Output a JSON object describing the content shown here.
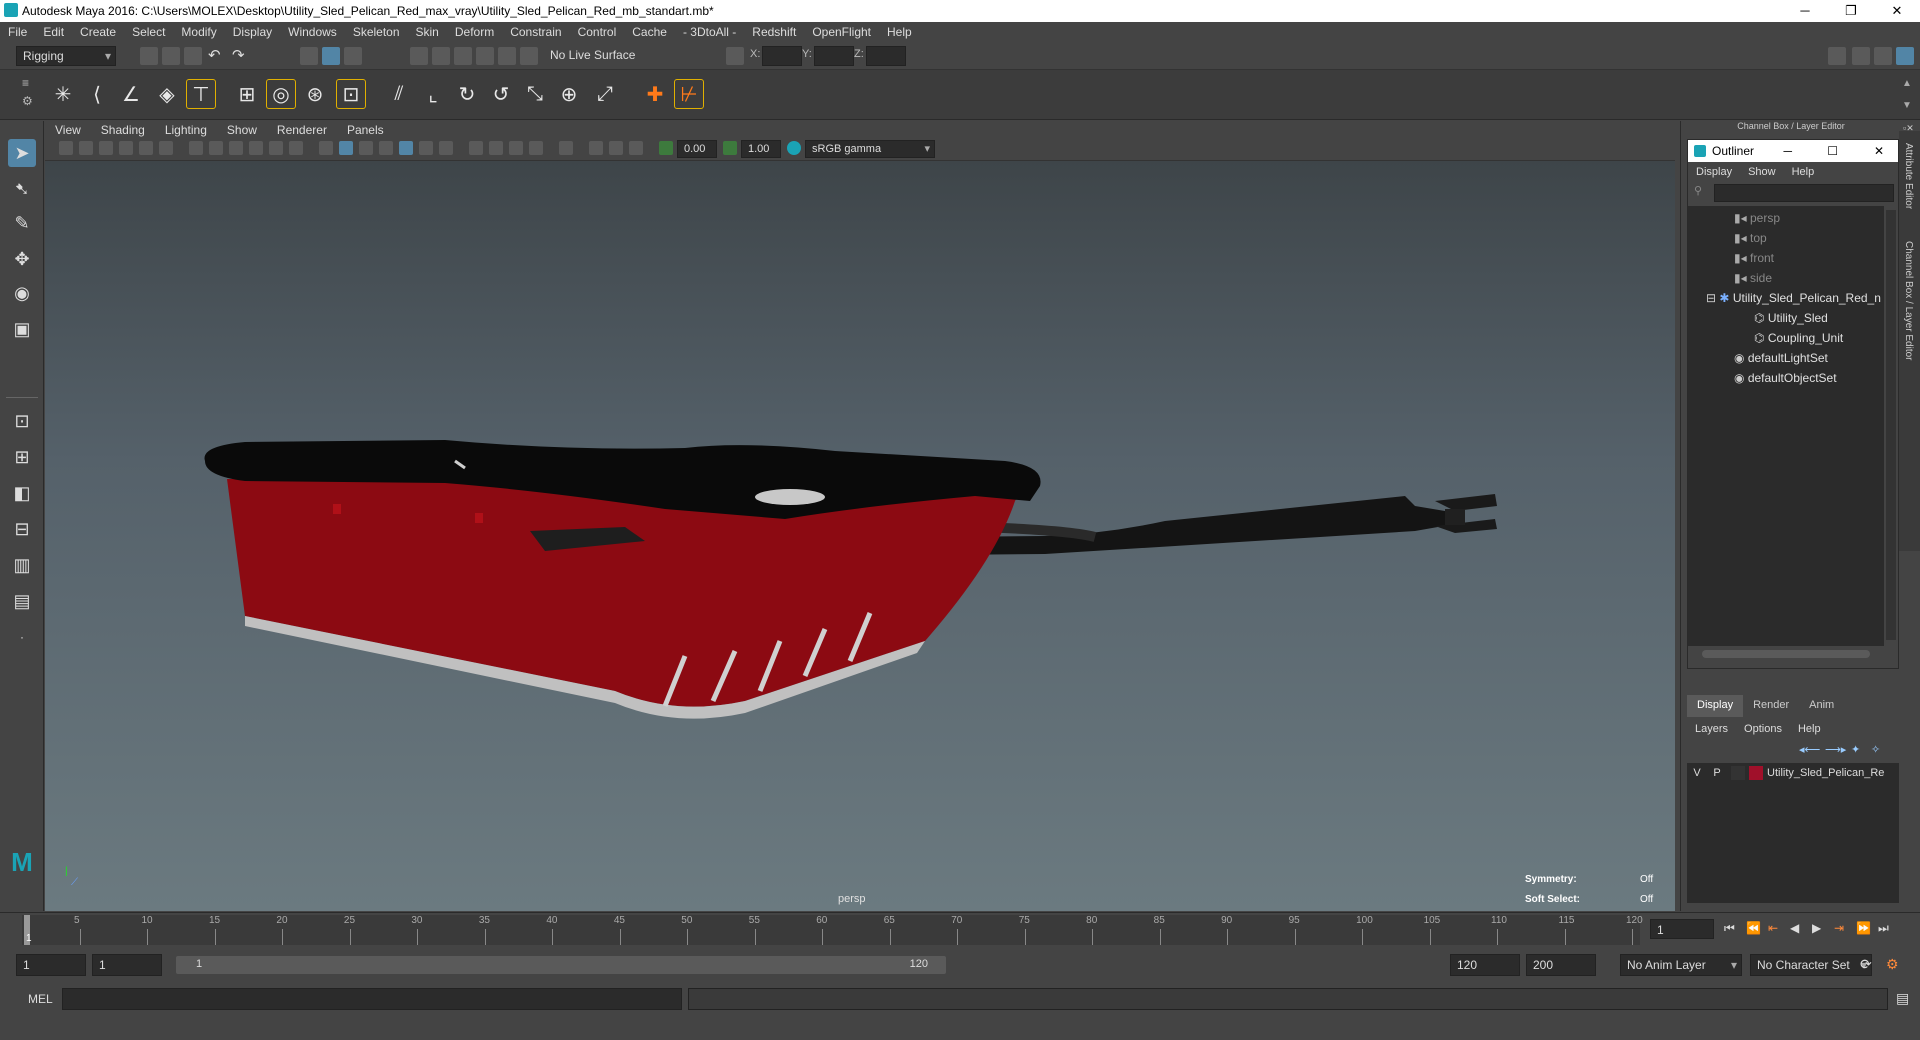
{
  "window": {
    "title": "Autodesk Maya 2016: C:\\Users\\MOLEX\\Desktop\\Utility_Sled_Pelican_Red_max_vray\\Utility_Sled_Pelican_Red_mb_standart.mb*",
    "minimize": "─",
    "maximize": "❐",
    "close": "✕"
  },
  "menubar": {
    "items": [
      "File",
      "Edit",
      "Create",
      "Select",
      "Modify",
      "Display",
      "Windows",
      "Skeleton",
      "Skin",
      "Deform",
      "Constrain",
      "Control",
      "Cache",
      "- 3DtoAll -",
      "Redshift",
      "OpenFlight",
      "Help"
    ]
  },
  "toolbar": {
    "mode": "Rigging",
    "live_surface": "No Live Surface",
    "x_label": "X:",
    "y_label": "Y:",
    "z_label": "Z:"
  },
  "viewport_menu": {
    "items": [
      "View",
      "Shading",
      "Lighting",
      "Show",
      "Renderer",
      "Panels"
    ]
  },
  "viewport_toolbar": {
    "exposure": "0.00",
    "gamma": "1.00",
    "color_space": "sRGB gamma"
  },
  "viewport": {
    "camera_label": "persp",
    "symmetry_label": "Symmetry:",
    "symmetry_value": "Off",
    "soft_select_label": "Soft Select:",
    "soft_select_value": "Off"
  },
  "channel_box": {
    "title": "Channel Box / Layer Editor",
    "side_tabs": [
      "Attribute Editor",
      "Channel Box / Layer Editor"
    ]
  },
  "outliner": {
    "title": "Outliner",
    "menu": [
      "Display",
      "Show",
      "Help"
    ],
    "items": [
      {
        "label": "persp",
        "dim": true
      },
      {
        "label": "top",
        "dim": true
      },
      {
        "label": "front",
        "dim": true
      },
      {
        "label": "side",
        "dim": true
      },
      {
        "label": "Utility_Sled_Pelican_Red_n",
        "dim": false
      },
      {
        "label": "Utility_Sled",
        "dim": false
      },
      {
        "label": "Coupling_Unit",
        "dim": false
      },
      {
        "label": "defaultLightSet",
        "dim": false
      },
      {
        "label": "defaultObjectSet",
        "dim": false
      }
    ]
  },
  "layer_editor": {
    "tabs": [
      "Display",
      "Render",
      "Anim"
    ],
    "menu": [
      "Layers",
      "Options",
      "Help"
    ],
    "layer": {
      "v": "V",
      "p": "P",
      "name": "Utility_Sled_Pelican_Re",
      "color": "#a0102a"
    }
  },
  "timeline": {
    "ticks": [
      "5",
      "10",
      "15",
      "20",
      "25",
      "30",
      "35",
      "40",
      "45",
      "50",
      "55",
      "60",
      "65",
      "70",
      "75",
      "80",
      "85",
      "90",
      "95",
      "100",
      "105",
      "110",
      "115",
      "120"
    ],
    "current_frame_label": "1",
    "current_frame_field": "1"
  },
  "range": {
    "start": "1",
    "start2": "1",
    "slider_start": "1",
    "slider_end": "120",
    "end": "120",
    "end2": "200",
    "anim_layer": "No Anim Layer",
    "character_set": "No Character Set"
  },
  "command": {
    "mel_label": "MEL"
  },
  "colors": {
    "sled_red": "#8c0a12",
    "sled_lid": "#0a0a0a",
    "accent": "#1aa3b5"
  }
}
